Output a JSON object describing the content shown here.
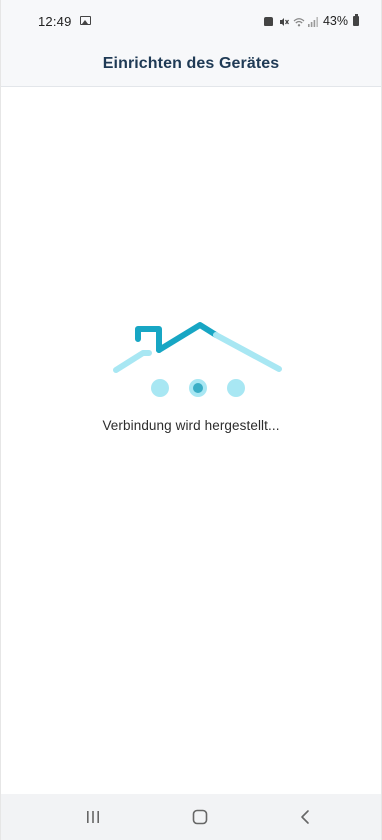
{
  "status_bar": {
    "time": "12:49",
    "battery": "43%",
    "icons": [
      "image-notification-icon",
      "alarm-icon",
      "mute-icon",
      "wifi-icon",
      "signal-icon",
      "battery-icon"
    ]
  },
  "header": {
    "title": "Einrichten des Gerätes"
  },
  "loader": {
    "graphic": "house-roof-icon",
    "dots": 3,
    "active_dot": 2,
    "message": "Verbindung wird hergestellt..."
  },
  "colors": {
    "accent": "#17a6c4",
    "accent_light": "#a8e7f3",
    "title": "#1f3a55",
    "header_bg": "#f7f8fa"
  },
  "nav_bar": {
    "buttons": [
      "recents-icon",
      "home-icon",
      "back-icon"
    ]
  }
}
